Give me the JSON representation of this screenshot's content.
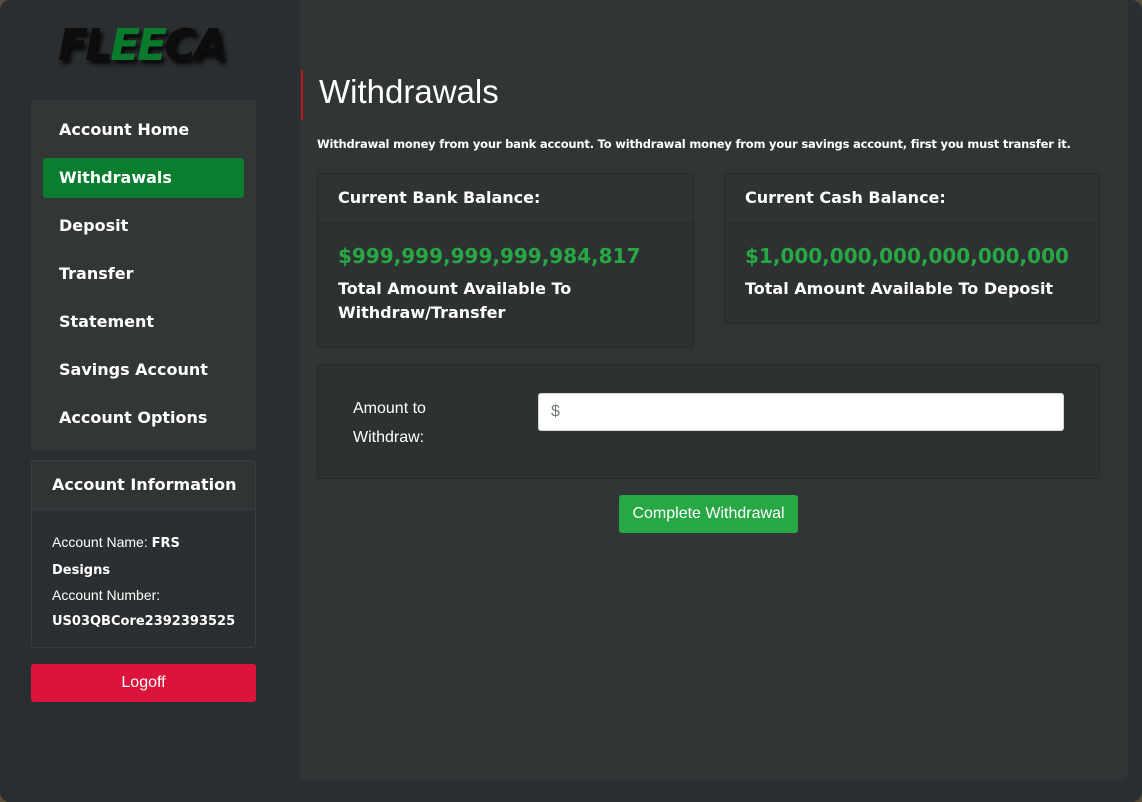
{
  "logo": {
    "part1": "FL",
    "part2": "EE",
    "part3": "CA"
  },
  "sidebar": {
    "items": [
      {
        "label": "Account Home",
        "active": false
      },
      {
        "label": "Withdrawals",
        "active": true
      },
      {
        "label": "Deposit",
        "active": false
      },
      {
        "label": "Transfer",
        "active": false
      },
      {
        "label": "Statement",
        "active": false
      },
      {
        "label": "Savings Account",
        "active": false
      },
      {
        "label": "Account Options",
        "active": false
      }
    ],
    "account_info": {
      "title": "Account Information",
      "name_label": "Account Name:",
      "name_value": "FRS Designs",
      "number_label": "Account Number:",
      "number_value": "US03QBCore2392393525"
    },
    "logoff_label": "Logoff"
  },
  "main": {
    "title": "Withdrawals",
    "description": "Withdrawal money from your bank account. To withdrawal money from your savings account, first you must transfer it.",
    "bank_card": {
      "header": "Current Bank Balance:",
      "amount": "$999,999,999,999,984,817",
      "caption": "Total Amount Available To Withdraw/Transfer"
    },
    "cash_card": {
      "header": "Current Cash Balance:",
      "amount": "$1,000,000,000,000,000,000",
      "caption": "Total Amount Available To Deposit"
    },
    "withdraw_form": {
      "label": "Amount to Withdraw:",
      "placeholder": "$",
      "value": ""
    },
    "complete_label": "Complete Withdrawal"
  },
  "colors": {
    "brand_green": "#0b7d2e",
    "amount_green": "#28a745",
    "logoff_red": "#dc143c",
    "title_accent": "#c0151d"
  }
}
